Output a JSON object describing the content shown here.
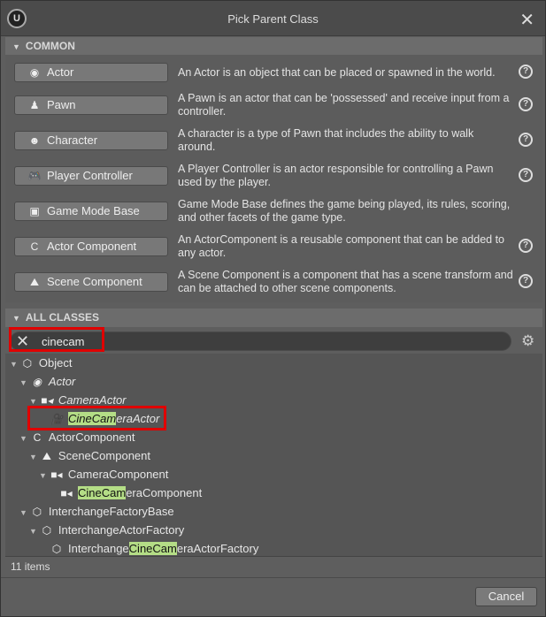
{
  "window": {
    "title": "Pick Parent Class",
    "logo": "U"
  },
  "common": {
    "header": "COMMON",
    "items": [
      {
        "label": "Actor",
        "icon": "actor-icon",
        "glyph": "◉",
        "desc": "An Actor is an object that can be placed or spawned in the world."
      },
      {
        "label": "Pawn",
        "icon": "pawn-icon",
        "glyph": "♟",
        "desc": "A Pawn is an actor that can be 'possessed' and receive input from a controller."
      },
      {
        "label": "Character",
        "icon": "character-icon",
        "glyph": "☻",
        "desc": "A character is a type of Pawn that includes the ability to walk around."
      },
      {
        "label": "Player Controller",
        "icon": "gamepad-icon",
        "glyph": "🎮",
        "desc": "A Player Controller is an actor responsible for controlling a Pawn used by the player."
      },
      {
        "label": "Game Mode Base",
        "icon": "game-mode-icon",
        "glyph": "▣",
        "desc": "Game Mode Base defines the game being played, its rules, scoring, and other facets of the game type."
      },
      {
        "label": "Actor Component",
        "icon": "actor-component-icon",
        "glyph": "C",
        "desc": "An ActorComponent is a reusable component that can be added to any actor."
      },
      {
        "label": "Scene Component",
        "icon": "scene-component-icon",
        "glyph": "⛰",
        "desc": "A Scene Component is a component that has a scene transform and can be attached to other scene components."
      }
    ]
  },
  "all_classes": {
    "header": "ALL CLASSES",
    "search_value": "cinecam",
    "tree": [
      {
        "pre": "Object",
        "hl": "",
        "post": "",
        "depth": 0,
        "italic": false,
        "arrow": true,
        "icon": "object-icon",
        "glyph": "⬡"
      },
      {
        "pre": "Actor",
        "hl": "",
        "post": "",
        "depth": 1,
        "italic": true,
        "arrow": true,
        "icon": "actor-icon",
        "glyph": "◉"
      },
      {
        "pre": "CameraActor",
        "hl": "",
        "post": "",
        "depth": 2,
        "italic": true,
        "arrow": true,
        "icon": "camera-icon",
        "glyph": "■◂"
      },
      {
        "pre": "",
        "hl": "CineCam",
        "post": "eraActor",
        "depth": 3,
        "italic": true,
        "arrow": false,
        "icon": "cine-camera-icon",
        "glyph": "🎥"
      },
      {
        "pre": "ActorComponent",
        "hl": "",
        "post": "",
        "depth": 1,
        "italic": false,
        "arrow": true,
        "icon": "actor-component-icon",
        "glyph": "C"
      },
      {
        "pre": "SceneComponent",
        "hl": "",
        "post": "",
        "depth": 2,
        "italic": false,
        "arrow": true,
        "icon": "scene-component-icon",
        "glyph": "⛰"
      },
      {
        "pre": "CameraComponent",
        "hl": "",
        "post": "",
        "depth": 3,
        "italic": false,
        "arrow": true,
        "icon": "camera-icon",
        "glyph": "■◂"
      },
      {
        "pre": "",
        "hl": "CineCam",
        "post": "eraComponent",
        "depth": 4,
        "italic": false,
        "arrow": false,
        "icon": "camera-icon",
        "glyph": "■◂"
      },
      {
        "pre": "InterchangeFactoryBase",
        "hl": "",
        "post": "",
        "depth": 1,
        "italic": false,
        "arrow": true,
        "icon": "object-icon",
        "glyph": "⬡"
      },
      {
        "pre": "InterchangeActorFactory",
        "hl": "",
        "post": "",
        "depth": 2,
        "italic": false,
        "arrow": true,
        "icon": "object-icon",
        "glyph": "⬡"
      },
      {
        "pre": "Interchange",
        "hl": "CineCam",
        "post": "eraActorFactory",
        "depth": 3,
        "italic": false,
        "arrow": false,
        "icon": "object-icon",
        "glyph": "⬡"
      }
    ],
    "count": "11 items"
  },
  "footer": {
    "cancel_label": "Cancel"
  },
  "colors": {
    "highlight": "#b4dd86",
    "annotation_box": "#e00000"
  }
}
